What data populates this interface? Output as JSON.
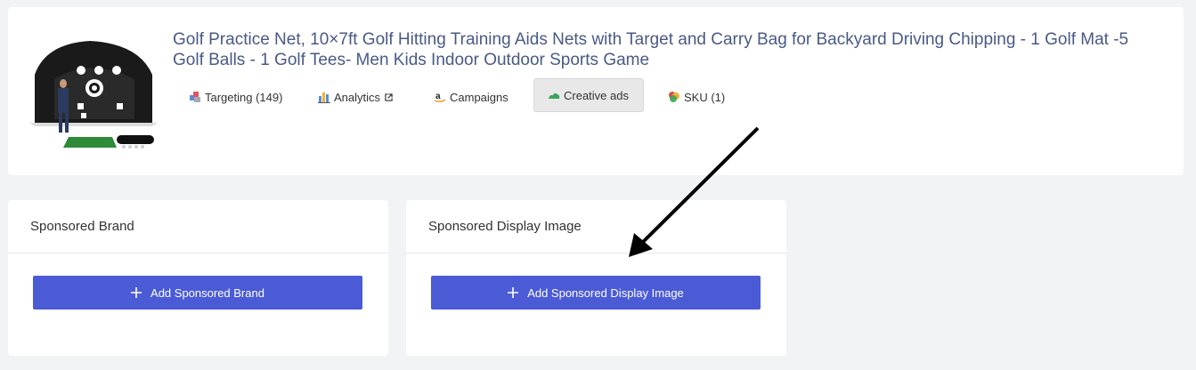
{
  "product": {
    "title": "Golf Practice Net, 10×7ft Golf Hitting Training Aids Nets with Target and Carry Bag for Backyard Driving Chipping - 1 Golf Mat -5 Golf Balls - 1 Golf Tees- Men Kids Indoor Outdoor Sports Game",
    "image_icon": "golf-net-product-image"
  },
  "tabs": [
    {
      "label": "Targeting (149)",
      "icon": "targeting-icon",
      "active": false
    },
    {
      "label": "Analytics",
      "icon": "analytics-icon",
      "active": false,
      "external": true
    },
    {
      "label": "Campaigns",
      "icon": "amazon-icon",
      "active": false
    },
    {
      "label": "Creative ads",
      "icon": "creative-ads-icon",
      "active": true
    },
    {
      "label": "SKU (1)",
      "icon": "sku-icon",
      "active": false
    }
  ],
  "panels": {
    "sponsored_brand": {
      "title": "Sponsored Brand",
      "button_label": "Add Sponsored Brand"
    },
    "sponsored_display": {
      "title": "Sponsored Display Image",
      "button_label": "Add Sponsored Display Image"
    }
  },
  "colors": {
    "accent": "#4b5bd6",
    "title_color": "#4a5a85",
    "background": "#f2f3f5"
  }
}
